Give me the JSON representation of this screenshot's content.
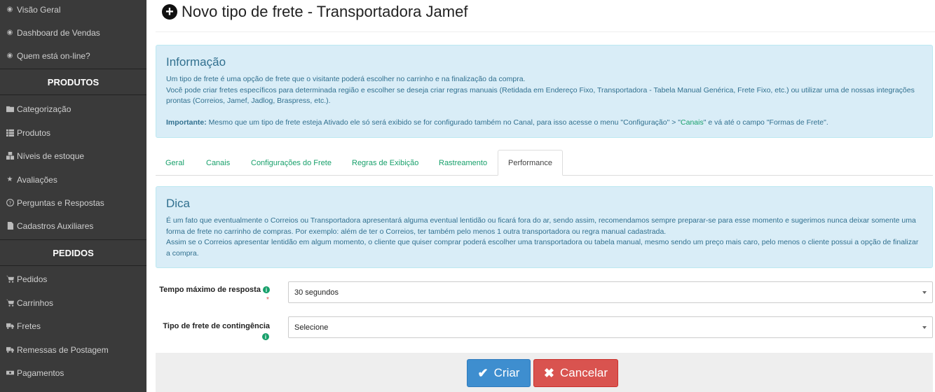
{
  "sidebar": {
    "items_top": [
      {
        "label": "Visão Geral",
        "icon": "dashboard-icon"
      },
      {
        "label": "Dashboard de Vendas",
        "icon": "dashboard-icon"
      },
      {
        "label": "Quem está on-line?",
        "icon": "dashboard-icon"
      }
    ],
    "section_produtos": "PRODUTOS",
    "items_produtos": [
      {
        "label": "Categorização",
        "icon": "folder-icon"
      },
      {
        "label": "Produtos",
        "icon": "list-icon"
      },
      {
        "label": "Níveis de estoque",
        "icon": "cubes-icon"
      },
      {
        "label": "Avaliações",
        "icon": "star-icon"
      },
      {
        "label": "Perguntas e Respostas",
        "icon": "question-icon"
      },
      {
        "label": "Cadastros Auxiliares",
        "icon": "file-icon"
      }
    ],
    "section_pedidos": "PEDIDOS",
    "items_pedidos": [
      {
        "label": "Pedidos",
        "icon": "cart-icon"
      },
      {
        "label": "Carrinhos",
        "icon": "cart-icon"
      },
      {
        "label": "Fretes",
        "icon": "truck-icon"
      },
      {
        "label": "Remessas de Postagem",
        "icon": "truck-icon"
      },
      {
        "label": "Pagamentos",
        "icon": "money-icon"
      }
    ]
  },
  "page": {
    "title": "Novo tipo de frete - Transportadora Jamef"
  },
  "info": {
    "heading": "Informação",
    "line1": "Um tipo de frete é uma opção de frete que o visitante poderá escolher no carrinho e na finalização da compra.",
    "line2": "Você pode criar fretes específicos para determinada região e escolher se deseja criar regras manuais (Retidada em Endereço Fixo, Transportadora - Tabela Manual Genérica, Frete Fixo, etc.) ou utilizar uma de nossas integrações prontas (Correios, Jamef, Jadlog, Braspress, etc.).",
    "important_label": "Importante:",
    "important_text_a": " Mesmo que um tipo de frete esteja Ativado ele só será exibido se for configurado também no Canal, para isso acesse o menu \"Configuração\" > \"",
    "important_link": "Canais",
    "important_text_b": "\" e vá até o campo \"Formas de Frete\"."
  },
  "tabs": [
    {
      "label": "Geral"
    },
    {
      "label": "Canais"
    },
    {
      "label": "Configurações do Frete"
    },
    {
      "label": "Regras de Exibição"
    },
    {
      "label": "Rastreamento"
    },
    {
      "label": "Performance"
    }
  ],
  "active_tab": "Performance",
  "tip": {
    "heading": "Dica",
    "line1": "É um fato que eventualmente o Correios ou Transportadora apresentará alguma eventual lentidão ou ficará fora do ar, sendo assim, recomendamos sempre preparar-se para esse momento e sugerimos nunca deixar somente uma forma de frete no carrinho de compras. Por exemplo: além de ter o Correios, ter também pelo menos 1 outra transportadora ou regra manual cadastrada.",
    "line2": "Assim se o Correios apresentar lentidão em algum momento, o cliente que quiser comprar poderá escolher uma transportadora ou tabela manual, mesmo sendo um preço mais caro, pelo menos o cliente possui a opção de finalizar a compra."
  },
  "form": {
    "max_time_label": "Tempo máximo de resposta",
    "max_time_value": "30 segundos",
    "required_mark": "*",
    "fallback_label": "Tipo de frete de contingência",
    "fallback_value": "Selecione"
  },
  "buttons": {
    "create": "Criar",
    "cancel": "Cancelar"
  },
  "colors": {
    "sidebar_bg": "#3a3a3a",
    "accent_green": "#18a06b",
    "alert_bg": "#d9edf7",
    "alert_text": "#31708f",
    "primary": "#3e8ecf",
    "danger": "#d9534f"
  }
}
